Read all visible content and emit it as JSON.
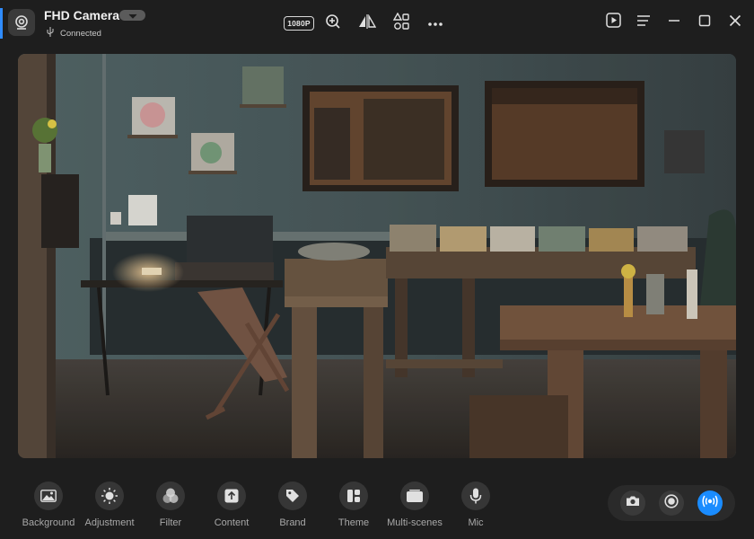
{
  "app": {
    "title": "FHD Camera",
    "status": "Connected",
    "accent_color": "#2f8cff"
  },
  "top_toolbar": {
    "resolution": "1080P",
    "icons": [
      "zoom-in-icon",
      "mirror-icon",
      "shapes-icon",
      "more-icon"
    ]
  },
  "window_controls": [
    "play-panel-icon",
    "menu-icon",
    "minimize-icon",
    "maximize-icon",
    "close-icon"
  ],
  "tools": [
    {
      "label": "Background",
      "icon": "image-icon"
    },
    {
      "label": "Adjustment",
      "icon": "sun-icon"
    },
    {
      "label": "Filter",
      "icon": "circles-icon"
    },
    {
      "label": "Content",
      "icon": "upload-icon"
    },
    {
      "label": "Brand",
      "icon": "tag-icon"
    },
    {
      "label": "Theme",
      "icon": "layout-icon"
    },
    {
      "label": "Multi-scenes",
      "icon": "scenes-icon"
    },
    {
      "label": "Mic",
      "icon": "mic-icon"
    }
  ],
  "capture": {
    "live_color": "#1a8cff",
    "icons": [
      "camera-icon",
      "record-icon",
      "live-icon"
    ]
  }
}
